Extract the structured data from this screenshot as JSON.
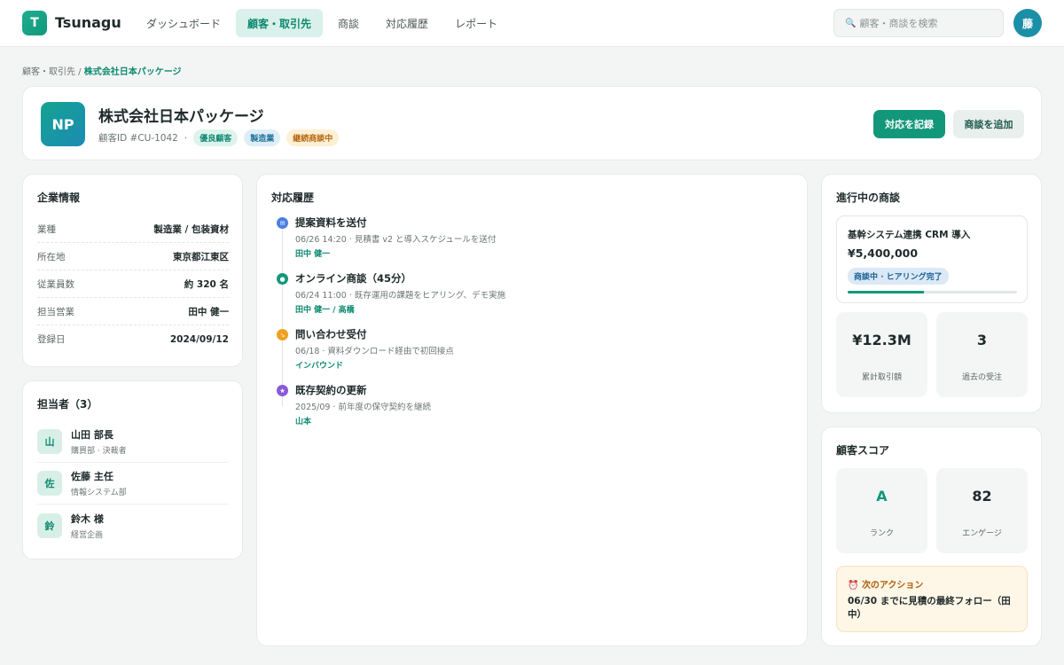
{
  "app": {
    "logo_letter": "T",
    "name": "Tsunagu"
  },
  "nav": [
    "ダッシュボード",
    "顧客・取引先",
    "商談",
    "対応履歴",
    "レポート"
  ],
  "search": {
    "placeholder": "顧客・商談を検索"
  },
  "user": {
    "avatar": "藤"
  },
  "breadcrumb": {
    "parent": "顧客・取引先",
    "sep": " / ",
    "current": "株式会社日本パッケージ"
  },
  "customer": {
    "initials": "NP",
    "name": "株式会社日本パッケージ",
    "id_text": "顧客ID #CU-1042",
    "dot": "·",
    "tags": [
      "優良顧客",
      "製造業",
      "継続商談中"
    ],
    "primary_button": "対応を記録",
    "secondary_button": "商談を追加"
  },
  "company_info": {
    "title": "企業情報",
    "rows": [
      {
        "key": "業種",
        "value": "製造業 / 包装資材"
      },
      {
        "key": "所在地",
        "value": "東京都江東区"
      },
      {
        "key": "従業員数",
        "value": "約 320 名"
      },
      {
        "key": "担当営業",
        "value": "田中 健一"
      },
      {
        "key": "登録日",
        "value": "2024/09/12"
      }
    ]
  },
  "contacts": {
    "title": "担当者（3）",
    "items": [
      {
        "avatar": "山",
        "name": "山田 部長",
        "role": "購買部 · 決裁者"
      },
      {
        "avatar": "佐",
        "name": "佐藤 主任",
        "role": "情報システム部"
      },
      {
        "avatar": "鈴",
        "name": "鈴木 様",
        "role": "経営企画"
      }
    ]
  },
  "timeline": {
    "title": "対応履歴",
    "items": [
      {
        "icon": "mail-icon",
        "glyph": "✉",
        "color": "#4a7fe0",
        "title": "提案資料を送付",
        "desc": "06/26 14:20 · 見積書 v2 と導入スケジュールを送付",
        "who": "田中 健一"
      },
      {
        "icon": "meeting-icon",
        "glyph": "●",
        "color": "#13977b",
        "title": "オンライン商談（45分）",
        "desc": "06/24 11:00 · 既存運用の課題をヒアリング、デモ実施",
        "who": "田中 健一 / 高橋"
      },
      {
        "icon": "inbound-icon",
        "glyph": "↘",
        "color": "#f0a020",
        "title": "問い合わせ受付",
        "desc": "06/18 · 資料ダウンロード経由で初回接点",
        "who": "インバウンド"
      },
      {
        "icon": "star-icon",
        "glyph": "★",
        "color": "#8a5ad8",
        "title": "既存契約の更新",
        "desc": "2025/09 · 前年度の保守契約を継続",
        "who": "山本"
      }
    ]
  },
  "deals": {
    "title": "進行中の商談",
    "deal": {
      "name": "基幹システム連携 CRM 導入",
      "amount": "¥5,400,000",
      "status": "商談中 · ヒアリング完了",
      "progress_pct": 45
    },
    "stats": [
      {
        "value": "¥12.3M",
        "label": "累計取引額"
      },
      {
        "value": "3",
        "label": "過去の受注"
      }
    ]
  },
  "score": {
    "title": "顧客スコア",
    "stats": [
      {
        "value": "A",
        "label": "ランク"
      },
      {
        "value": "82",
        "label": "エンゲージ"
      }
    ],
    "next_action": {
      "icon": "⏰",
      "title": "次のアクション",
      "text": "06/30 までに見積の最終フォロー（田中）"
    }
  },
  "colors": {
    "accent": "#13977b",
    "accent_light": "#d9f1ea",
    "background": "#f3f5f4"
  }
}
